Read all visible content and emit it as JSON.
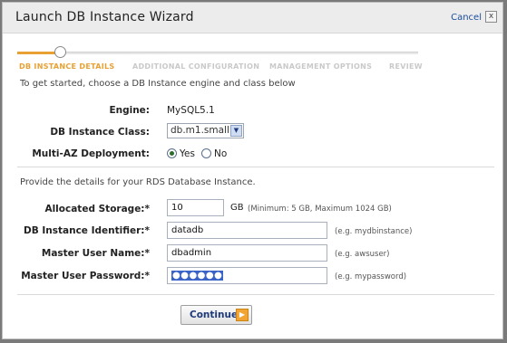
{
  "window": {
    "title": "Launch DB Instance Wizard",
    "cancel_label": "Cancel",
    "close_symbol": "x"
  },
  "steps": [
    {
      "label": "DB INSTANCE DETAILS",
      "active": true
    },
    {
      "label": "ADDITIONAL CONFIGURATION",
      "active": false
    },
    {
      "label": "MANAGEMENT OPTIONS",
      "active": false
    },
    {
      "label": "REVIEW",
      "active": false
    }
  ],
  "engine_section": {
    "intro": "To get started, choose a DB Instance engine and class below",
    "engine_label": "Engine:",
    "engine_value": "MySQL5.1",
    "class_label": "DB Instance Class:",
    "class_value": "db.m1.small",
    "multi_az_label": "Multi-AZ Deployment:",
    "multi_az_options": [
      {
        "label": "Yes",
        "checked": true
      },
      {
        "label": "No",
        "checked": false
      }
    ]
  },
  "details_section": {
    "intro": "Provide the details for your RDS Database Instance.",
    "storage_label": "Allocated Storage:*",
    "storage_value": "10",
    "storage_unit": "GB",
    "storage_hint": "(Minimum: 5 GB, Maximum 1024 GB)",
    "identifier_label": "DB Instance Identifier:*",
    "identifier_value": "datadb",
    "identifier_hint": "(e.g. mydbinstance)",
    "username_label": "Master User Name:*",
    "username_value": "dbadmin",
    "username_hint": "(e.g. awsuser)",
    "password_label": "Master User Password:*",
    "password_value": "●●●●●●",
    "password_hint": "(e.g. mypassword)"
  },
  "footer": {
    "continue_label": "Continue",
    "continue_arrow": "▶"
  },
  "colors": {
    "accent": "#e8a033",
    "link": "#1a4c9c"
  }
}
